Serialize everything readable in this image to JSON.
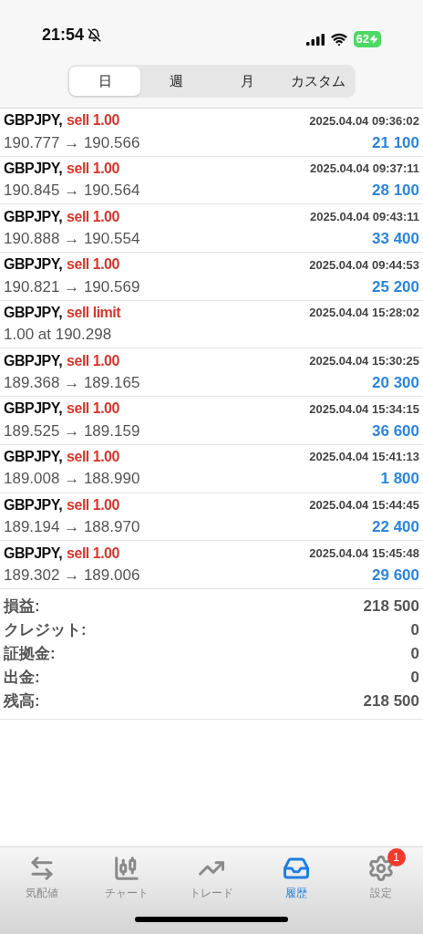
{
  "status_bar": {
    "time": "21:54",
    "battery": "62"
  },
  "segments": [
    {
      "label": "日",
      "selected": true
    },
    {
      "label": "週",
      "selected": false
    },
    {
      "label": "月",
      "selected": false
    },
    {
      "label": "カスタム",
      "selected": false
    }
  ],
  "deals": [
    {
      "kind": "deal",
      "symbol": "GBPJPY,",
      "type": "sell 1.00",
      "time": "2025.04.04 09:36:02",
      "prices": "190.777 → 190.566",
      "profit": "21 100"
    },
    {
      "kind": "deal",
      "symbol": "GBPJPY,",
      "type": "sell 1.00",
      "time": "2025.04.04 09:37:11",
      "prices": "190.845 → 190.564",
      "profit": "28 100"
    },
    {
      "kind": "deal",
      "symbol": "GBPJPY,",
      "type": "sell 1.00",
      "time": "2025.04.04 09:43:11",
      "prices": "190.888 → 190.554",
      "profit": "33 400"
    },
    {
      "kind": "deal",
      "symbol": "GBPJPY,",
      "type": "sell 1.00",
      "time": "2025.04.04 09:44:53",
      "prices": "190.821 → 190.569",
      "profit": "25 200"
    },
    {
      "kind": "order",
      "symbol": "GBPJPY,",
      "type": "sell limit",
      "time": "2025.04.04 15:28:02",
      "prices": "1.00 at 190.298"
    },
    {
      "kind": "deal",
      "symbol": "GBPJPY,",
      "type": "sell 1.00",
      "time": "2025.04.04 15:30:25",
      "prices": "189.368 → 189.165",
      "profit": "20 300"
    },
    {
      "kind": "deal",
      "symbol": "GBPJPY,",
      "type": "sell 1.00",
      "time": "2025.04.04 15:34:15",
      "prices": "189.525 → 189.159",
      "profit": "36 600"
    },
    {
      "kind": "deal",
      "symbol": "GBPJPY,",
      "type": "sell 1.00",
      "time": "2025.04.04 15:41:13",
      "prices": "189.008 → 188.990",
      "profit": "1 800"
    },
    {
      "kind": "deal",
      "symbol": "GBPJPY,",
      "type": "sell 1.00",
      "time": "2025.04.04 15:44:45",
      "prices": "189.194 → 188.970",
      "profit": "22 400"
    },
    {
      "kind": "deal",
      "symbol": "GBPJPY,",
      "type": "sell 1.00",
      "time": "2025.04.04 15:45:48",
      "prices": "189.302 → 189.006",
      "profit": "29 600"
    }
  ],
  "summary": [
    {
      "label": "損益:",
      "value": "218 500"
    },
    {
      "label": "クレジット:",
      "value": "0"
    },
    {
      "label": "証拠金:",
      "value": "0"
    },
    {
      "label": "出金:",
      "value": "0"
    },
    {
      "label": "残高:",
      "value": "218 500"
    }
  ],
  "tab_bar": [
    {
      "kind": "quotes",
      "label": "気配値",
      "selected": false
    },
    {
      "kind": "chart",
      "label": "チャート",
      "selected": false
    },
    {
      "kind": "trade",
      "label": "トレード",
      "selected": false
    },
    {
      "kind": "history",
      "label": "履歴",
      "selected": true
    },
    {
      "kind": "settings",
      "label": "設定",
      "selected": false,
      "badge": "1"
    }
  ]
}
